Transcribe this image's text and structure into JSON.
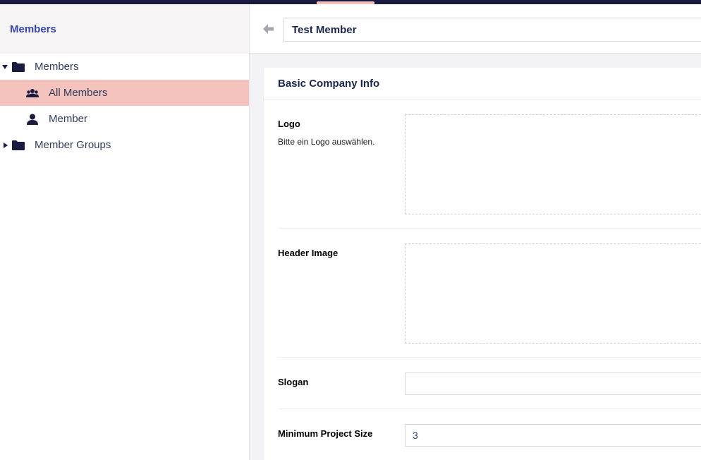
{
  "sidebar": {
    "title": "Members",
    "tree": [
      {
        "label": "Members",
        "icon": "folder-icon",
        "expanded": true,
        "active": false
      },
      {
        "label": "All Members",
        "icon": "users-icon",
        "active": true
      },
      {
        "label": "Member",
        "icon": "user-icon",
        "active": false
      },
      {
        "label": "Member Groups",
        "icon": "folder-icon",
        "expanded": false,
        "active": false
      }
    ]
  },
  "header": {
    "name_value": "Test Member"
  },
  "panel": {
    "title": "Basic Company Info",
    "properties": {
      "logo": {
        "label": "Logo",
        "description": "Bitte ein Logo auswählen."
      },
      "header_image": {
        "label": "Header Image"
      },
      "slogan": {
        "label": "Slogan",
        "value": ""
      },
      "min_project_size": {
        "label": "Minimum Project Size",
        "value": "3"
      }
    }
  },
  "colors": {
    "topbar": "#1b1a3f",
    "active_item": "#f4c3be",
    "sidebar_title": "#3544b1",
    "text_dark": "#1b264f"
  }
}
